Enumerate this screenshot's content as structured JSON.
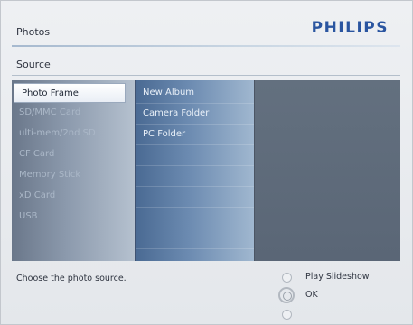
{
  "header": {
    "title": "Photos",
    "brand": "PHILIPS"
  },
  "section": {
    "label": "Source"
  },
  "sources": [
    {
      "label": "Photo Frame",
      "selected": true
    },
    {
      "label": "SD/MMC Card"
    },
    {
      "label": "ulti-mem/2nd SD"
    },
    {
      "label": "CF Card"
    },
    {
      "label": "Memory Stick"
    },
    {
      "label": "xD Card"
    },
    {
      "label": "USB"
    }
  ],
  "albums": [
    {
      "label": "New Album"
    },
    {
      "label": "Camera Folder"
    },
    {
      "label": "PC Folder"
    }
  ],
  "footer": {
    "hint": "Choose the photo source.",
    "play_label": "Play Slideshow",
    "ok_label": "OK"
  },
  "colors": {
    "brand": "#2a55a0",
    "panel_bg": "#5a6473",
    "selection_bg": "#ffffff"
  },
  "icons": {
    "play": "radio-circle-icon",
    "ok": "ok-button-icon",
    "down": "radio-circle-icon"
  }
}
